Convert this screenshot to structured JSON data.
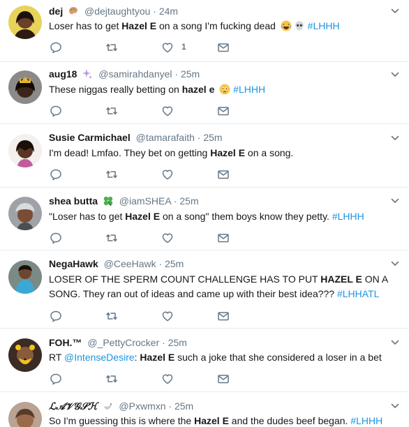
{
  "tweets": [
    {
      "name": "dej",
      "handle": "@dejtaughtyou",
      "sep": "·",
      "time": "24m",
      "parts": {
        "p1": "Loser has to get ",
        "b1": "Hazel E",
        "p2": " on a song I'm fucking dead ",
        "tag": "#LHHH"
      },
      "like_count": "1"
    },
    {
      "name": "aug18",
      "handle": "@samirahdanyel",
      "sep": "·",
      "time": "25m",
      "parts": {
        "p1": "These niggas really betting on ",
        "b1": "hazel e",
        "tag": "#LHHH"
      }
    },
    {
      "name": "Susie Carmichael",
      "handle": "@tamarafaith",
      "sep": "·",
      "time": "25m",
      "parts": {
        "p1": "I'm dead! Lmfao. They bet on getting ",
        "b1": "Hazel E",
        "p2": " on a song."
      }
    },
    {
      "name": "shea butta",
      "handle": "@iamSHEA",
      "sep": "·",
      "time": "25m",
      "parts": {
        "p1": "\"Loser has to get ",
        "b1": "Hazel E",
        "p2": " on a song\" them boys know they petty. ",
        "tag": "#LHHH"
      }
    },
    {
      "name": "NegaHawk",
      "handle": "@CeeHawk",
      "sep": "·",
      "time": "25m",
      "parts": {
        "p1": "LOSER OF THE SPERM COUNT CHALLENGE HAS TO PUT ",
        "b1": "HAZEL E",
        "p2": " ON A SONG. They ran out of ideas and came up with their best idea??? ",
        "tag": "#LHHATL"
      }
    },
    {
      "name": "FOH.™",
      "handle": "@_PettyCrocker",
      "sep": "·",
      "time": "25m",
      "parts": {
        "p1": "RT ",
        "mention": "@IntenseDesire",
        "p2": ": ",
        "b1": "Hazel E",
        "p3": " such a joke that she considered a loser in a bet"
      }
    },
    {
      "name": "ℒ𝒜𝒱𝒢𝒮ℋ",
      "handle": "@Pxwmxn",
      "sep": "·",
      "time": "25m",
      "parts": {
        "p1": "So I'm guessing this is where the ",
        "b1": "Hazel E",
        "p2": " and the dudes beef began. ",
        "tag": "#LHHH"
      }
    }
  ],
  "colors": {
    "link": "#1b95e0",
    "secondary": "#657786",
    "divider": "#e6ecf0",
    "text": "#14171a"
  },
  "icons": [
    "reply-icon",
    "retweet-icon",
    "like-icon",
    "direct-message-icon",
    "caret-down-icon"
  ]
}
